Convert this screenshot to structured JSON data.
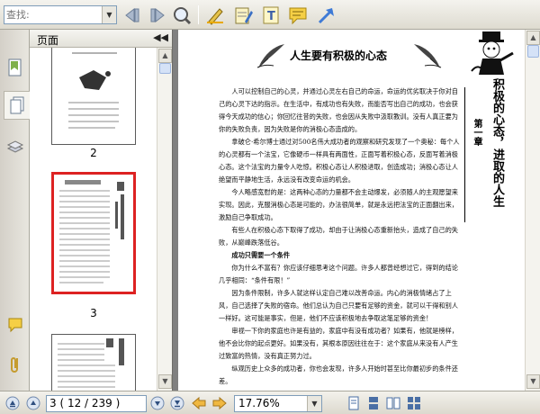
{
  "toolbar": {
    "search_placeholder": "查找:",
    "dropdown_arrow": "▼"
  },
  "left_panel": {
    "title": "页面",
    "collapse_glyph": "◀◀",
    "thumbnails": [
      {
        "label": "2"
      },
      {
        "label": "3"
      }
    ]
  },
  "document": {
    "title": "人生要有积极的心态",
    "side_heading": "积极的心态，进取的人生",
    "side_chapter": "第一章",
    "paragraphs": [
      "人可以控制自己的心灵，并通过心灵左右自己的命运，命运的优劣取决于你对自己的心灵下达的指示。在生活中，有成功也有失败，而能否写出自己的成功，也会获得今天成功的信心；你回忆往昔的失败，也会因从失败中汲取教训。没有人真正要为你的失败负责，因为失败是你的消极心态造成的。",
      "拿破仑·希尔博士通过对500名伟大成功者的观察和研究发现了一个奥秘：每个人的心灵都有一个法宝，它像硬币一样具有两面性，正面写着积极心态，反面写着消极心态。这个法宝的力量令人吃惊。积极心态让人积极进取，创造成功；消极心态让人绝望而平静地生活，永远没有改变命运的机会。",
      "今人略感宽慰的是：这两种心态的力量都不会主动爆发，必须随人的主观愿望来实现。因此，克服消极心态是可能的，办法很简单，就是永远把法宝的正面翻出来，激励自己争取成功。",
      "有些人在积极心态下取得了成功，却由于让消极心态重新抬头，造成了自己的失败，从巅峰跌落低谷。"
    ],
    "subheading": "成功只需要一个条件",
    "paragraphs2": [
      "你为什么不富有？你应该仔细思考这个问题。许多人都曾经想过它，得到的结论几乎相同：“条件有限！”",
      "因为条件限制，许多人就这样认定自己难以改善命运。内心的消极情绪占了上风，自己选择了失败的宿命。他们总认为自己只要有足够的资金，就可以干得和别人一样好。这可能是事实，但是，他们不应该积极地去争取这笔足够的资金！",
      "审视一下你的家庭也许是有益的，家庭中有没有成功者？如果有，他就是榜样，他不会比你的起点更好。如果没有，其根本原因往往在于：这个家庭从来没有人产生过致富的热情，没有真正努力过。",
      "纵观历史上众多的成功者，你也会发现，许多人开始时甚至比你最初步的条件还差。"
    ]
  },
  "bottombar": {
    "page_display": "3 ( 12 / 239 )",
    "zoom": "17.76%"
  }
}
